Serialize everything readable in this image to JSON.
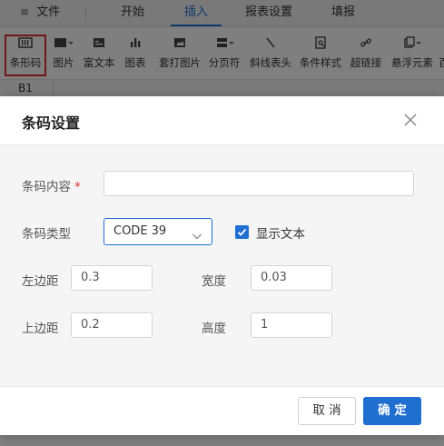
{
  "menubar": {
    "file_label": "文件",
    "tabs": [
      "开始",
      "插入",
      "报表设置",
      "填报"
    ],
    "active_tab": "插入"
  },
  "toolbar": {
    "items": [
      {
        "label": "条形码",
        "icon": "barcode-icon"
      },
      {
        "label": "图片",
        "icon": "image-icon"
      },
      {
        "label": "富文本",
        "icon": "rich-text-icon"
      },
      {
        "label": "图表",
        "icon": "chart-icon"
      },
      {
        "label": "套打图片",
        "icon": "print-image-icon"
      },
      {
        "label": "分页符",
        "icon": "page-break-icon"
      },
      {
        "label": "斜线表头",
        "icon": "diagonal-header-icon"
      },
      {
        "label": "条件样式",
        "icon": "condition-style-icon"
      },
      {
        "label": "超链接",
        "icon": "link-icon"
      },
      {
        "label": "悬浮元素",
        "icon": "float-element-icon"
      },
      {
        "label": "百",
        "icon": ""
      }
    ],
    "selected": "条形码"
  },
  "formula_bar": {
    "cell_ref": "B1"
  },
  "dialog": {
    "title": "条码设置",
    "fields": {
      "content_label": "条码内容",
      "required_mark": "*",
      "content_value": "",
      "type_label": "条码类型",
      "type_value": "CODE 39",
      "show_text_label": "显示文本",
      "show_text_checked": true,
      "left_margin_label": "左边距",
      "left_margin_value": "0.3",
      "width_label": "宽度",
      "width_value": "0.03",
      "top_margin_label": "上边距",
      "top_margin_value": "0.2",
      "height_label": "高度",
      "height_value": "1"
    },
    "cancel_label": "取 消",
    "ok_label": "确 定"
  },
  "colors": {
    "accent": "#1f6fd1",
    "highlight_border": "#e0302b",
    "overlay": "rgba(0,0,0,0.5)"
  }
}
